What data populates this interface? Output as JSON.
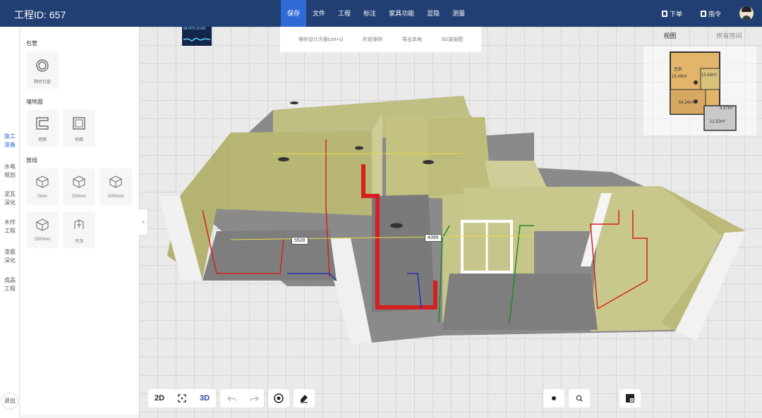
{
  "header": {
    "project_label": "工程ID:",
    "project_id": "657",
    "menu": [
      "保存",
      "文件",
      "工程",
      "标注",
      "家具功能",
      "显隐",
      "测量"
    ],
    "actions": {
      "order": "下单",
      "command": "指令"
    }
  },
  "left_nav": {
    "items": [
      "施工\n准备",
      "水电\n规划",
      "泥瓦\n深化",
      "木作\n工程",
      "漆面\n深化",
      "成品\n工程"
    ],
    "exit": "退出"
  },
  "panel": {
    "sections": [
      {
        "title": "包管",
        "items": [
          "隔音包管"
        ]
      },
      {
        "title": "墙地面",
        "items": [
          "墙面",
          "地面"
        ]
      },
      {
        "title": "放线",
        "items": [
          "0mm",
          "300mm",
          "1000mm",
          "1500mm",
          "吊顶"
        ]
      }
    ]
  },
  "subbar": {
    "items": [
      "保存设计方案(ctrl+s)",
      "阶段保存",
      "导出本地",
      "5G渲染图"
    ]
  },
  "fps": {
    "label": "68 FPS (0-68)"
  },
  "view_tabs": [
    "视图",
    "所有房间"
  ],
  "minimap": {
    "rooms": [
      "主卧",
      "15.49m²",
      "13.63m²",
      "54.34m²",
      "3.37m²",
      "12.52m²"
    ]
  },
  "measurements": [
    "5528",
    "4395"
  ],
  "bottom_toolbar": {
    "mode_2d": "2D",
    "mode_3d": "3D"
  },
  "colors": {
    "header_bg": "#213f73",
    "active_menu": "#2f6bd6",
    "wall": "#b9b878",
    "pipe_red": "#d42020",
    "pipe_green": "#1f8a2a"
  }
}
